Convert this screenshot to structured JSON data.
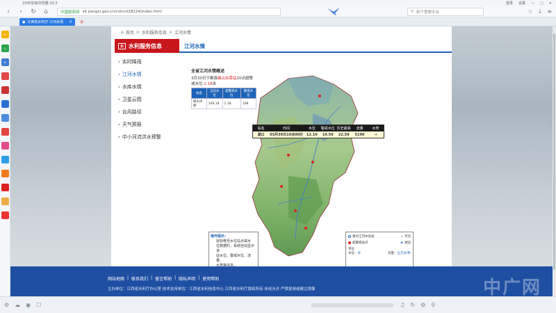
{
  "window": {
    "title": "2345加速浏览器 10.3",
    "controls": [
      "登录",
      "设置",
      "—",
      "□",
      "✕"
    ]
  },
  "toolbar": {
    "secure_label": "中国政府网",
    "url": "slt.jiangxi.gov.cn/col/col28224/index.html",
    "search_placeholder": "新千里眼平台"
  },
  "tabs": [
    {
      "label": "江西省水利厅 江河水情"
    }
  ],
  "breadcrumb": {
    "home": "首页",
    "sep1": ">",
    "level1": "水利服务信息",
    "sep2": ">",
    "level2": "江河水情"
  },
  "section": {
    "title": "水利服务信息",
    "logo_text": "水",
    "subtitle": "江河水情"
  },
  "menu": [
    {
      "label": "实时降雨",
      "active": false
    },
    {
      "label": "江河水情",
      "active": true
    },
    {
      "label": "水库水情",
      "active": false
    },
    {
      "label": "卫星云图",
      "active": false
    },
    {
      "label": "台风路径",
      "active": false
    },
    {
      "label": "天气预报",
      "active": false
    },
    {
      "label": "中小河流洪水预警",
      "active": false
    }
  ],
  "overview": {
    "title": "全省江河水情概述",
    "text_pre": "3月30日于都县",
    "text_red": "峡山水库站",
    "text_post": "10点超警戒水位:",
    "text_level": "1.18",
    "text_unit": "米",
    "headers": [
      "站名",
      "当前水位",
      "超警戒水位",
      "警戒水位"
    ],
    "rows": [
      [
        "峡山水库",
        "109.18",
        "1.18",
        "108"
      ]
    ]
  },
  "station": {
    "headers": [
      "站名",
      "时间",
      "水位",
      "警戒水位",
      "历史最高",
      "流量",
      "水势"
    ],
    "row": [
      "湖口",
      "03月30日10点00分",
      "12.10",
      "19.50",
      "22.59",
      "5190",
      ""
    ]
  },
  "tip": {
    "title": "操作提示：",
    "lines": [
      "鼠标移至水位站点或水",
      "位数据时，系统自动显示该",
      "站水位、警戒水位、流量、",
      "水势等信息。"
    ]
  },
  "legend": {
    "items": [
      "重点江河水位站",
      "河流",
      "超警戒站点",
      "湖泊"
    ],
    "unit_label": "单位",
    "water_label": "水位：",
    "water_unit": "米",
    "flow_label": "流量：",
    "flow_unit": "立方米/秒"
  },
  "footer": {
    "links": [
      "网站地图",
      "|",
      "联系我们",
      "|",
      "留言帮助",
      "|",
      "隐私声明",
      "|",
      "使用帮助"
    ],
    "info": "主办单位：江西省水利厅办公室   技术支持单位：江西省水利信息中心 江西省水利厅版权所有 未经允许 严禁复制或建立镜像",
    "watermark": "中广网"
  },
  "colors": {
    "accent": "#1e63b8",
    "brand_red": "#c8161d",
    "footer": "#1e4fa3",
    "tab": "#2c7be5"
  }
}
